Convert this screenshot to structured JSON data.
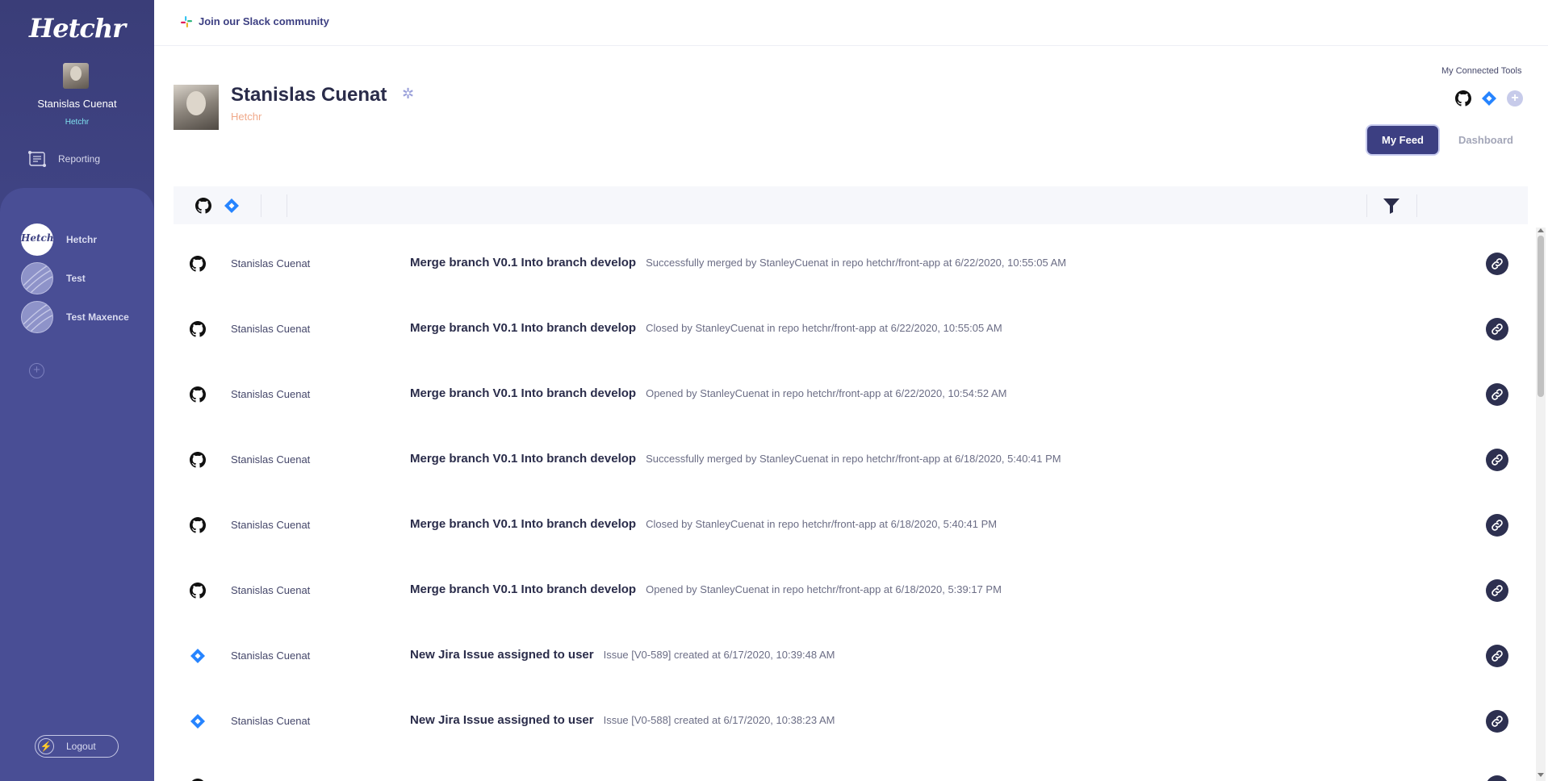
{
  "app": {
    "logo_text": "Hetchr",
    "colors": {
      "sidebar": "#3f4383",
      "panel": "#494e95",
      "accent": "#3c3f82",
      "jira": "#2684ff",
      "org": "#f0a98a"
    }
  },
  "sidebar": {
    "user_name": "Stanislas Cuenat",
    "org_name": "Hetchr",
    "reporting_label": "Reporting",
    "workspaces": [
      {
        "label": "Hetchr",
        "active": true,
        "icon": "hetchr-logo-icon"
      },
      {
        "label": "Test",
        "active": false,
        "icon": "workspace-globe-icon"
      },
      {
        "label": "Test Maxence",
        "active": false,
        "icon": "workspace-globe-icon"
      }
    ],
    "add_workspace": "+",
    "logout_label": "Logout"
  },
  "topbar": {
    "slack_label": "Join our Slack community"
  },
  "profile": {
    "name": "Stanislas Cuenat",
    "org": "Hetchr",
    "tools_label": "My Connected Tools",
    "tools": [
      "github-icon",
      "jira-icon"
    ],
    "add_tool": "+"
  },
  "tabs": {
    "feed": "My Feed",
    "dashboard": "Dashboard"
  },
  "filters": {
    "sources": [
      "github-icon",
      "jira-icon"
    ]
  },
  "feed": [
    {
      "source": "github",
      "user": "Stanislas Cuenat",
      "title": "Merge branch V0.1 Into branch develop",
      "detail": "Successfully merged by StanleyCuenat in repo hetchr/front-app at 6/22/2020, 10:55:05 AM"
    },
    {
      "source": "github",
      "user": "Stanislas Cuenat",
      "title": "Merge branch V0.1 Into branch develop",
      "detail": "Closed by StanleyCuenat in repo hetchr/front-app at 6/22/2020, 10:55:05 AM"
    },
    {
      "source": "github",
      "user": "Stanislas Cuenat",
      "title": "Merge branch V0.1 Into branch develop",
      "detail": "Opened by StanleyCuenat in repo hetchr/front-app at 6/22/2020, 10:54:52 AM"
    },
    {
      "source": "github",
      "user": "Stanislas Cuenat",
      "title": "Merge branch V0.1 Into branch develop",
      "detail": "Successfully merged by StanleyCuenat in repo hetchr/front-app at 6/18/2020, 5:40:41 PM"
    },
    {
      "source": "github",
      "user": "Stanislas Cuenat",
      "title": "Merge branch V0.1 Into branch develop",
      "detail": "Closed by StanleyCuenat in repo hetchr/front-app at 6/18/2020, 5:40:41 PM"
    },
    {
      "source": "github",
      "user": "Stanislas Cuenat",
      "title": "Merge branch V0.1 Into branch develop",
      "detail": "Opened by StanleyCuenat in repo hetchr/front-app at 6/18/2020, 5:39:17 PM"
    },
    {
      "source": "jira",
      "user": "Stanislas Cuenat",
      "title": "New Jira Issue assigned to user",
      "detail": "Issue [V0-589] created at 6/17/2020, 10:39:48 AM"
    },
    {
      "source": "jira",
      "user": "Stanislas Cuenat",
      "title": "New Jira Issue assigned to user",
      "detail": "Issue [V0-588] created at 6/17/2020, 10:38:23 AM"
    },
    {
      "source": "github",
      "user": "",
      "title": "",
      "detail": ""
    }
  ]
}
